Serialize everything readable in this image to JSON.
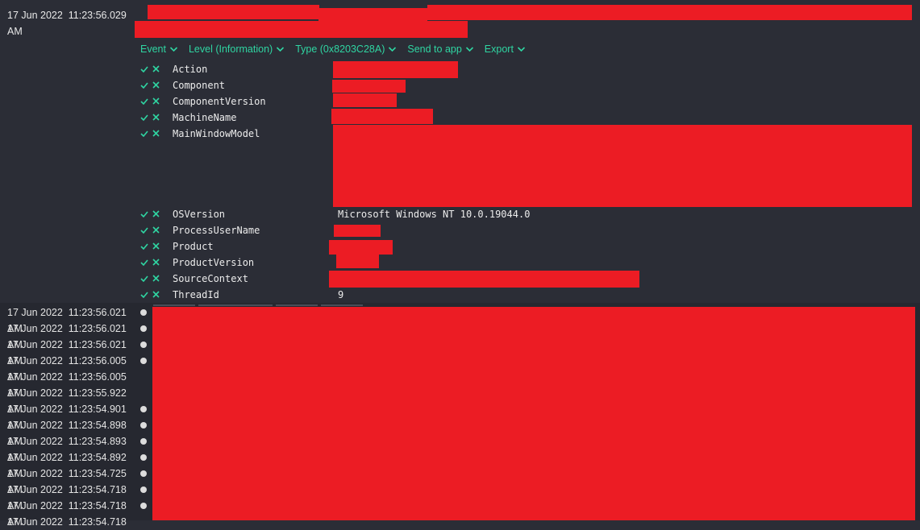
{
  "expanded_event": {
    "date": "17 Jun 2022",
    "time": "11:23:56.029",
    "ampm": "AM",
    "menus": [
      {
        "label": "Event"
      },
      {
        "label": "Level (Information)"
      },
      {
        "label": "Type (0x8203C28A)"
      },
      {
        "label": "Send to app"
      },
      {
        "label": "Export"
      }
    ],
    "properties": [
      {
        "name": "Action",
        "value": ""
      },
      {
        "name": "Component",
        "value": ""
      },
      {
        "name": "ComponentVersion",
        "value": ""
      },
      {
        "name": "MachineName",
        "value": ""
      },
      {
        "name": "MainWindowModel",
        "value": ""
      },
      {
        "name": "OSVersion",
        "value": "Microsoft Windows NT 10.0.19044.0"
      },
      {
        "name": "ProcessUserName",
        "value": ""
      },
      {
        "name": "Product",
        "value": ""
      },
      {
        "name": "ProductVersion",
        "value": ""
      },
      {
        "name": "SourceContext",
        "value": ""
      },
      {
        "name": "ThreadId",
        "value": "9"
      }
    ]
  },
  "event_list": {
    "overlap_text": "AM",
    "rows": [
      {
        "date": "17 Jun 2022",
        "time": "11:23:56.021",
        "dot": true
      },
      {
        "date": "17 Jun 2022",
        "time": "11:23:56.021",
        "dot": true
      },
      {
        "date": "17 Jun 2022",
        "time": "11:23:56.021",
        "dot": true
      },
      {
        "date": "17 Jun 2022",
        "time": "11:23:56.005",
        "dot": true
      },
      {
        "date": "17 Jun 2022",
        "time": "11:23:56.005",
        "dot": false
      },
      {
        "date": "17 Jun 2022",
        "time": "11:23:55.922",
        "dot": false
      },
      {
        "date": "17 Jun 2022",
        "time": "11:23:54.901",
        "dot": true
      },
      {
        "date": "17 Jun 2022",
        "time": "11:23:54.898",
        "dot": true
      },
      {
        "date": "17 Jun 2022",
        "time": "11:23:54.893",
        "dot": true
      },
      {
        "date": "17 Jun 2022",
        "time": "11:23:54.892",
        "dot": true
      },
      {
        "date": "17 Jun 2022",
        "time": "11:23:54.725",
        "dot": true
      },
      {
        "date": "17 Jun 2022",
        "time": "11:23:54.718",
        "dot": true
      },
      {
        "date": "17 Jun 2022",
        "time": "11:23:54.718",
        "dot": true
      },
      {
        "date": "17 Jun 2022",
        "time": "11:23:54.718",
        "dot": false
      }
    ]
  },
  "colors": {
    "accent": "#2fd5a2",
    "redaction": "#ec1c24",
    "background": "#2b2d36"
  },
  "icons": {
    "include": "check-icon",
    "exclude": "x-icon",
    "menu": "chevron-down-icon",
    "level": "dot-icon"
  }
}
